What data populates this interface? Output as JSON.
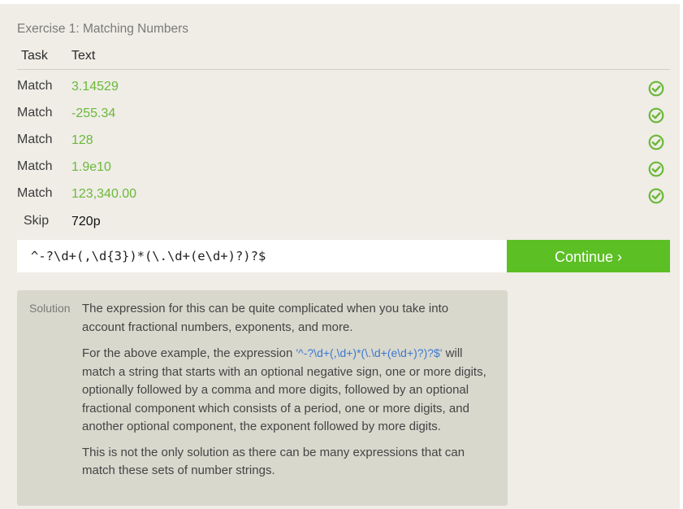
{
  "exercise": {
    "title": "Exercise 1: Matching Numbers",
    "headers": {
      "task": "Task",
      "text": "Text"
    },
    "rows": [
      {
        "task": "Match",
        "text": "3.14529",
        "status": "check-circle-icon"
      },
      {
        "task": "Match",
        "text": "-255.34",
        "status": "check-circle-icon"
      },
      {
        "task": "Match",
        "text": "128",
        "status": "check-circle-icon"
      },
      {
        "task": "Match",
        "text": "1.9e10",
        "status": "check-circle-icon"
      },
      {
        "task": "Match",
        "text": "123,340.00",
        "status": "check-circle-icon"
      },
      {
        "task": "Skip",
        "text": "720p",
        "status": ""
      }
    ],
    "input_value": "^-?\\d+(,\\d{3})*(\\.\\d+(e\\d+)?)?$",
    "continue_label": "Continue ›"
  },
  "solution": {
    "label": "Solution",
    "p1": "The expression for this can be quite complicated when you take into account fractional numbers, exponents, and more.",
    "p2_before": "For the above example, the expression ",
    "p2_code": "'^-?\\d+(,\\d+)*(\\.\\d+(e\\d+)?)?$'",
    "p2_after": " will match a string that starts with an optional negative sign, one or more digits, optionally followed by a comma and more digits, followed by an optional fractional component which consists of a period, one or more digits, and another optional component, the exponent followed by more digits.",
    "p3": "This is not the only solution as there can be many expressions that can match these sets of number strings."
  },
  "colors": {
    "match_text": "#6bb83a",
    "check_icon": "#6bb83a",
    "continue_button": "#5cbf24",
    "panel_bg": "#efede6",
    "solution_bg": "#d9d8cd",
    "code_text": "#3c79d0"
  }
}
